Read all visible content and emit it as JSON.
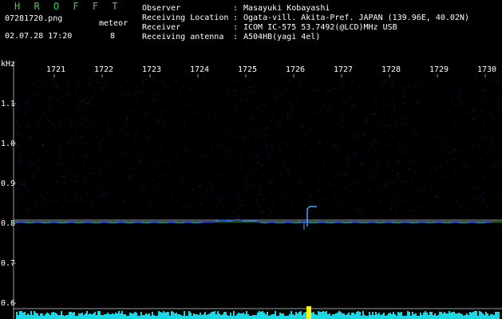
{
  "app": {
    "title": "H R O F F T"
  },
  "capture": {
    "filename": "07281720.png",
    "datetime": "02.07.28 17:20",
    "event_label": "meteor",
    "event_count": "8"
  },
  "info": [
    {
      "label": "Observer",
      "value": "Masayuki Kobayashi"
    },
    {
      "label": "Receiving Location",
      "value": "Ogata-vill. Akita-Pref. JAPAN (139.96E, 40.02N)"
    },
    {
      "label": "Receiver",
      "value": "ICOM IC-575 53.7492(@LCD)MHz USB"
    },
    {
      "label": "Receiving antenna",
      "value": "A504HB(yagi 4el)"
    }
  ],
  "separator": ":",
  "plot": {
    "y_unit": "kHz",
    "x_ticks": [
      "1721",
      "1722",
      "1723",
      "1724",
      "1725",
      "1726",
      "1727",
      "1728",
      "1729",
      "1730"
    ],
    "y_ticks": [
      "1.1",
      "1.0",
      "0.9",
      "0.8",
      "0.7",
      "0.6"
    ],
    "colors": {
      "background": "#000000",
      "axis": "#9a9a9a",
      "ref_line": "#25c025",
      "signal": "#2a62ff",
      "noise": "#1ad9e6",
      "highlight": "#ffff00"
    }
  }
}
